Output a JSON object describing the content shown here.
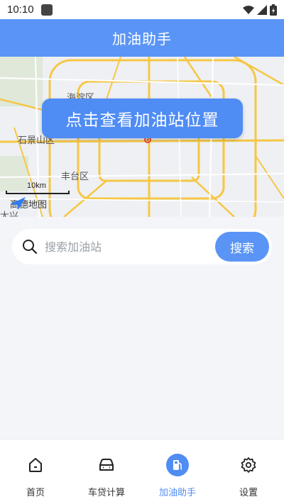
{
  "status": {
    "time": "10:10"
  },
  "header": {
    "title": "加油助手"
  },
  "map": {
    "labels": {
      "haidian": "海淀区",
      "shijingshan": "石景山区",
      "fengtai": "丰台区",
      "bottom_cut": "大兴"
    },
    "scale": "10km",
    "logo_text": "高德地图",
    "button_label": "点击查看加油站位置"
  },
  "search": {
    "placeholder": "搜索加油站",
    "value": "",
    "button_label": "搜索"
  },
  "nav": {
    "items": [
      {
        "label": "首页",
        "icon": "home-icon"
      },
      {
        "label": "车贷计算",
        "icon": "car-icon"
      },
      {
        "label": "加油助手",
        "icon": "fuel-pump-icon",
        "active": true
      },
      {
        "label": "设置",
        "icon": "gear-icon"
      }
    ]
  },
  "colors": {
    "primary": "#5a95f6",
    "active": "#4f8cf4",
    "road": "#f6c744"
  }
}
